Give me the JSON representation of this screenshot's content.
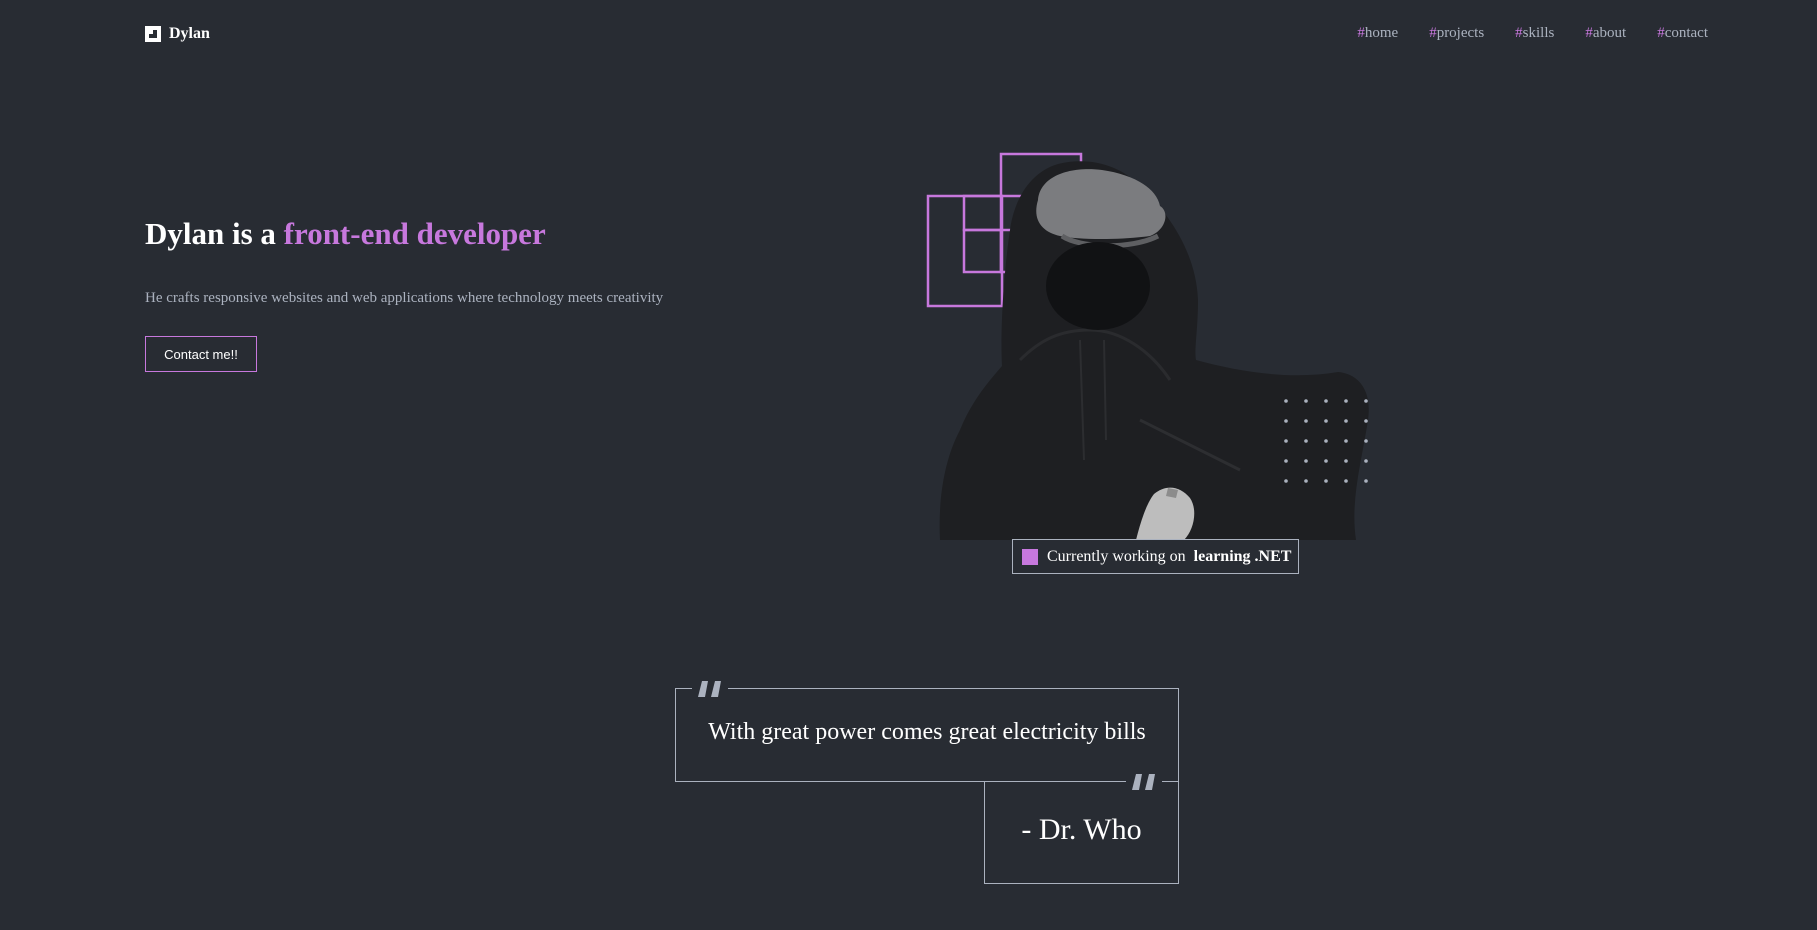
{
  "header": {
    "logo_text": "Dylan",
    "nav": [
      {
        "hash": "#",
        "label": "home"
      },
      {
        "hash": "#",
        "label": "projects"
      },
      {
        "hash": "#",
        "label": "skills"
      },
      {
        "hash": "#",
        "label": "about"
      },
      {
        "hash": "#",
        "label": "contact"
      }
    ]
  },
  "hero": {
    "title_prefix": "Dylan is a ",
    "title_accent": "front-end developer",
    "subtitle": "He crafts responsive websites and web applications where technology meets creativity",
    "cta_label": "Contact me!!"
  },
  "status": {
    "prefix": "Currently working on",
    "project": "learning .NET"
  },
  "quote": {
    "text": "With great power comes great electricity bills",
    "author": "- Dr. Who"
  },
  "colors": {
    "background": "#282c33",
    "accent": "#c778dd",
    "text_muted": "#abb2bf",
    "text_primary": "#ffffff"
  },
  "icons": {
    "logo": "logo-mark-icon",
    "quote": "quote-icon",
    "status": "status-square-icon"
  }
}
